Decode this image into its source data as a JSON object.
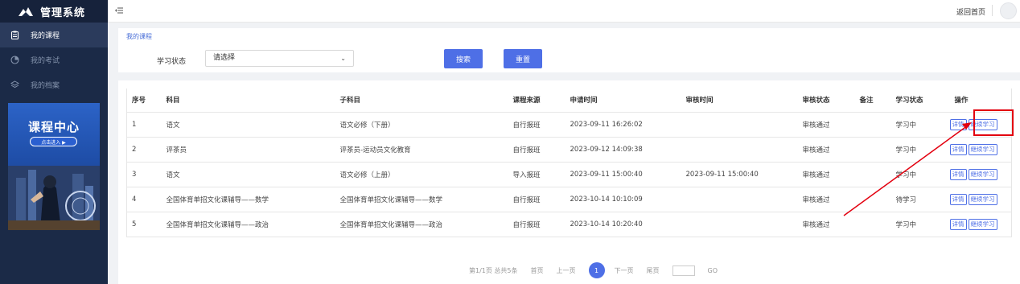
{
  "app": {
    "title": "管理系统"
  },
  "sidebar": {
    "items": [
      {
        "label": "我的课程",
        "icon": "clipboard-icon",
        "active": true
      },
      {
        "label": "我的考试",
        "icon": "pie-chart-icon",
        "active": false
      },
      {
        "label": "我的档案",
        "icon": "layers-icon",
        "active": false
      }
    ],
    "promo": {
      "title": "课程中心",
      "button": "点击进入 ▶"
    }
  },
  "topbar": {
    "home_link": "返回首页"
  },
  "breadcrumb": "我的课程",
  "filter": {
    "label": "学习状态",
    "select_value": "请选择",
    "search_label": "搜索",
    "reset_label": "重置"
  },
  "table": {
    "headers": [
      "序号",
      "科目",
      "子科目",
      "课程来源",
      "申请时间",
      "审核时间",
      "审核状态",
      "备注",
      "学习状态",
      "操作"
    ],
    "detail_label": "详情",
    "continue_label": "继续学习",
    "rows": [
      [
        "1",
        "语文",
        "语文必修（下册）",
        "自行报班",
        "2023-09-11 16:26:02",
        "",
        "审核通过",
        "",
        "学习中"
      ],
      [
        "2",
        "评茶员",
        "评茶员-运动员文化教育",
        "自行报班",
        "2023-09-12 14:09:38",
        "",
        "审核通过",
        "",
        "学习中"
      ],
      [
        "3",
        "语文",
        "语文必修（上册）",
        "导入报班",
        "2023-09-11 15:00:40",
        "2023-09-11 15:00:40",
        "审核通过",
        "",
        "学习中"
      ],
      [
        "4",
        "全国体育单招文化课辅导——数学",
        "全国体育单招文化课辅导——数学",
        "自行报班",
        "2023-10-14 10:10:09",
        "",
        "审核通过",
        "",
        "待学习"
      ],
      [
        "5",
        "全国体育单招文化课辅导——政治",
        "全国体育单招文化课辅导——政治",
        "自行报班",
        "2023-10-14 10:20:40",
        "",
        "审核通过",
        "",
        "学习中"
      ]
    ]
  },
  "pagination": {
    "summary": "第1/1页 总共5条",
    "first": "首页",
    "prev": "上一页",
    "current": "1",
    "next": "下一页",
    "last": "尾页",
    "go": "GO"
  },
  "colors": {
    "accent": "#4e6fe6",
    "sidebar_bg": "#1b2a47",
    "annotation": "#e3000f"
  }
}
